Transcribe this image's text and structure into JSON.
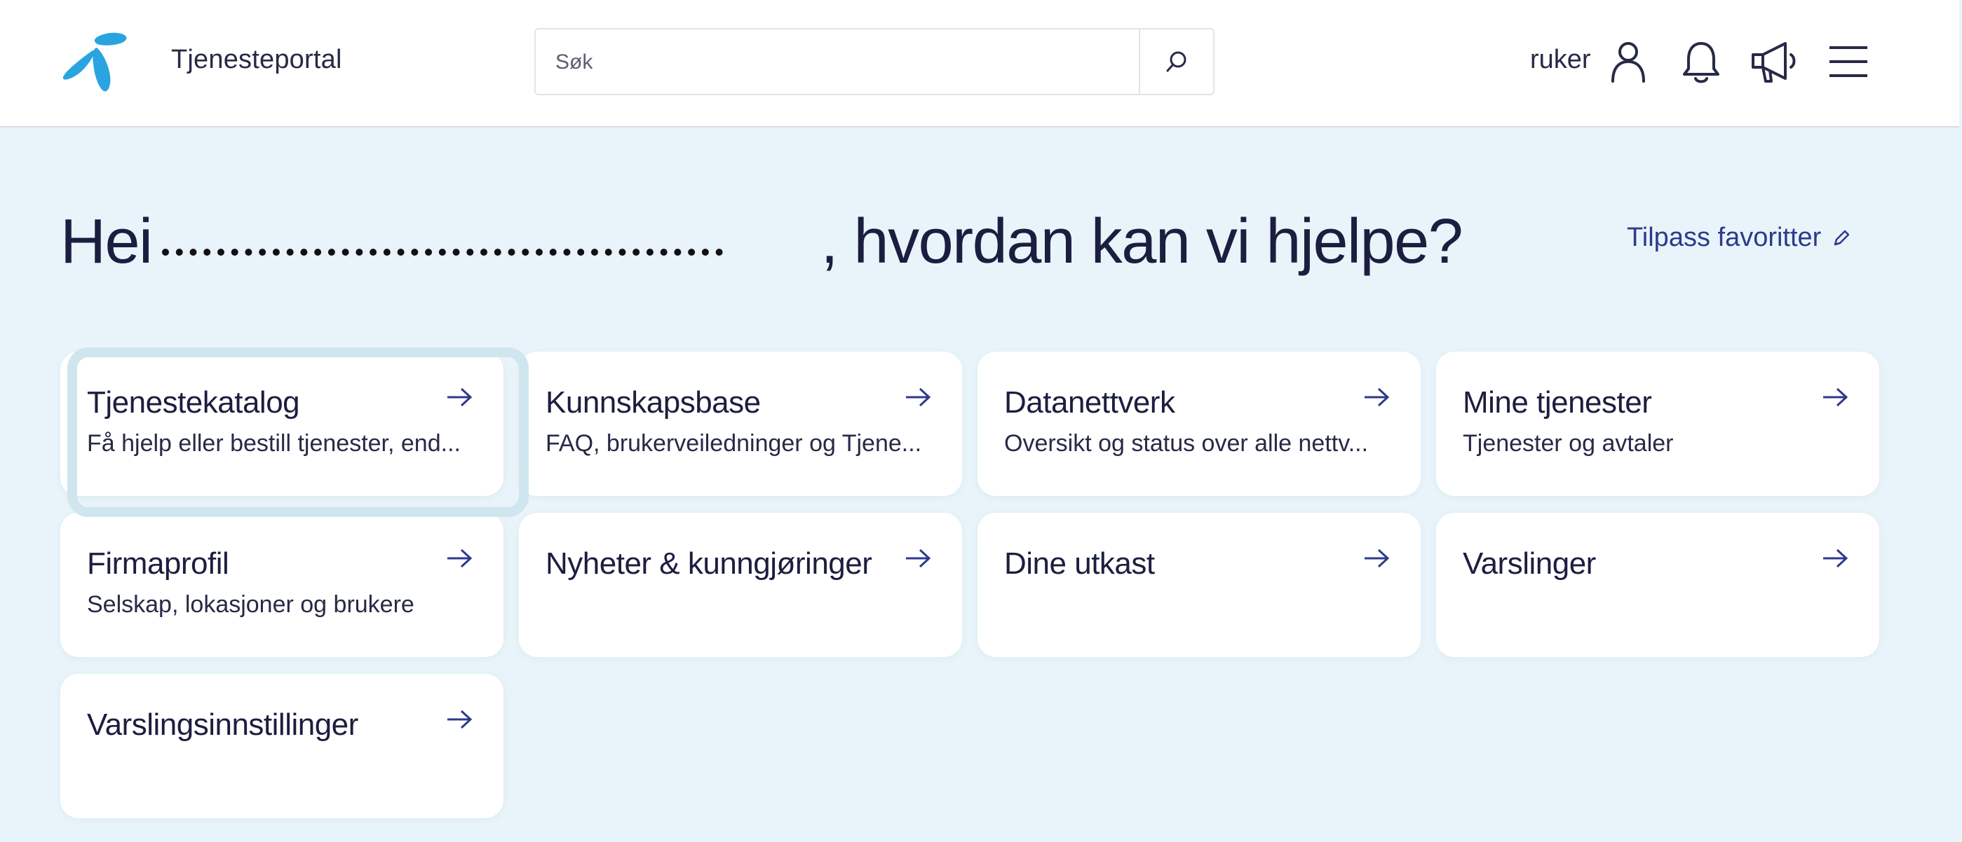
{
  "header": {
    "title": "Tjenesteportal",
    "search_placeholder": "Søk",
    "user_name": "ruker"
  },
  "greeting": {
    "prefix": "Hei",
    "suffix": ", hvordan kan vi hjelpe?"
  },
  "customize_label": "Tilpass favoritter",
  "cards": [
    {
      "title": "Tjenestekatalog",
      "desc": "Få hjelp eller bestill tjenester, end..."
    },
    {
      "title": "Kunnskapsbase",
      "desc": "FAQ, brukerveiledninger og Tjene..."
    },
    {
      "title": "Datanettverk",
      "desc": "Oversikt og status over alle nettv..."
    },
    {
      "title": "Mine tjenester",
      "desc": "Tjenester og avtaler"
    },
    {
      "title": "Firmaprofil",
      "desc": "Selskap, lokasjoner og brukere"
    },
    {
      "title": "Nyheter & kunngjøringer",
      "desc": ""
    },
    {
      "title": "Dine utkast",
      "desc": ""
    },
    {
      "title": "Varslinger",
      "desc": ""
    },
    {
      "title": "Varslingsinnstillinger",
      "desc": ""
    }
  ],
  "colors": {
    "background": "#e8f4f9",
    "brand": "#2aa4e0",
    "accent_link": "#2d3a8c",
    "text": "#1b1e3f"
  },
  "icons": {
    "logo": "telia-logo",
    "search": "search-icon",
    "user": "user-icon",
    "notifications": "bell-icon",
    "announcements": "megaphone-icon",
    "menu": "hamburger-menu-icon",
    "edit": "pencil-icon",
    "card_arrow": "arrow-right-icon"
  }
}
